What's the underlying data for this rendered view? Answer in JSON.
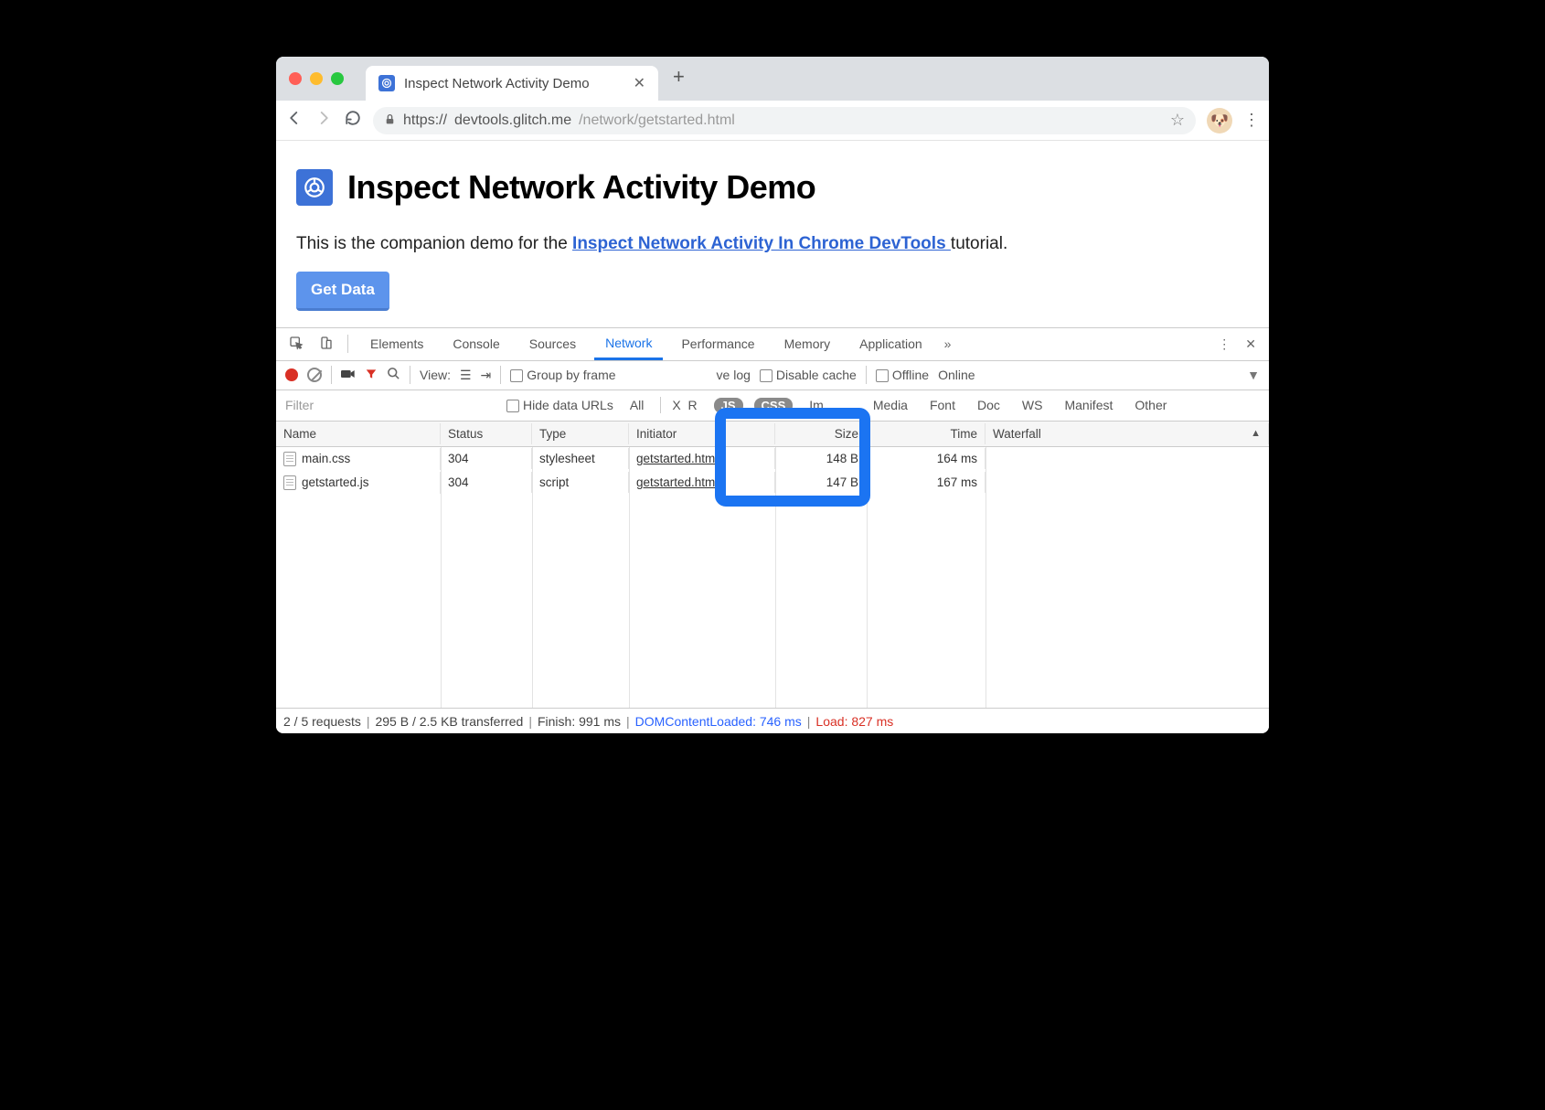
{
  "browser": {
    "tab_title": "Inspect Network Activity Demo",
    "url_prefix": "https://",
    "url_host": "devtools.glitch.me",
    "url_path": "/network/getstarted.html",
    "avatar_emoji": "🐶"
  },
  "page": {
    "title": "Inspect Network Activity Demo",
    "intro_before": "This is the companion demo for the ",
    "link_text": "Inspect Network Activity In Chrome DevTools ",
    "intro_after": "tutorial.",
    "button": "Get Data"
  },
  "devtools": {
    "tabs": [
      "Elements",
      "Console",
      "Sources",
      "Network",
      "Performance",
      "Memory",
      "Application"
    ],
    "active_tab": "Network",
    "toolbar": {
      "view_label": "View:",
      "group_by_frame": "Group by frame",
      "preserve_log_fragment": "ve log",
      "disable_cache": "Disable cache",
      "offline": "Offline",
      "online": "Online"
    },
    "filter": {
      "placeholder": "Filter",
      "hide_data_urls": "Hide data URLs",
      "types": [
        "All",
        "XHR",
        "JS",
        "CSS",
        "Img",
        "Media",
        "Font",
        "Doc",
        "WS",
        "Manifest",
        "Other"
      ],
      "selected": [
        "JS",
        "CSS"
      ]
    },
    "columns": [
      "Name",
      "Status",
      "Type",
      "Initiator",
      "Size",
      "Time",
      "Waterfall"
    ],
    "rows": [
      {
        "name": "main.css",
        "status": "304",
        "type": "stylesheet",
        "initiator": "getstarted.html",
        "size": "148 B",
        "time": "164 ms"
      },
      {
        "name": "getstarted.js",
        "status": "304",
        "type": "script",
        "initiator": "getstarted.html",
        "size": "147 B",
        "time": "167 ms"
      }
    ],
    "status": {
      "requests": "2 / 5 requests",
      "transferred": "295 B / 2.5 KB transferred",
      "finish": "Finish: 991 ms",
      "dcl": "DOMContentLoaded: 746 ms",
      "load": "Load: 827 ms"
    }
  }
}
